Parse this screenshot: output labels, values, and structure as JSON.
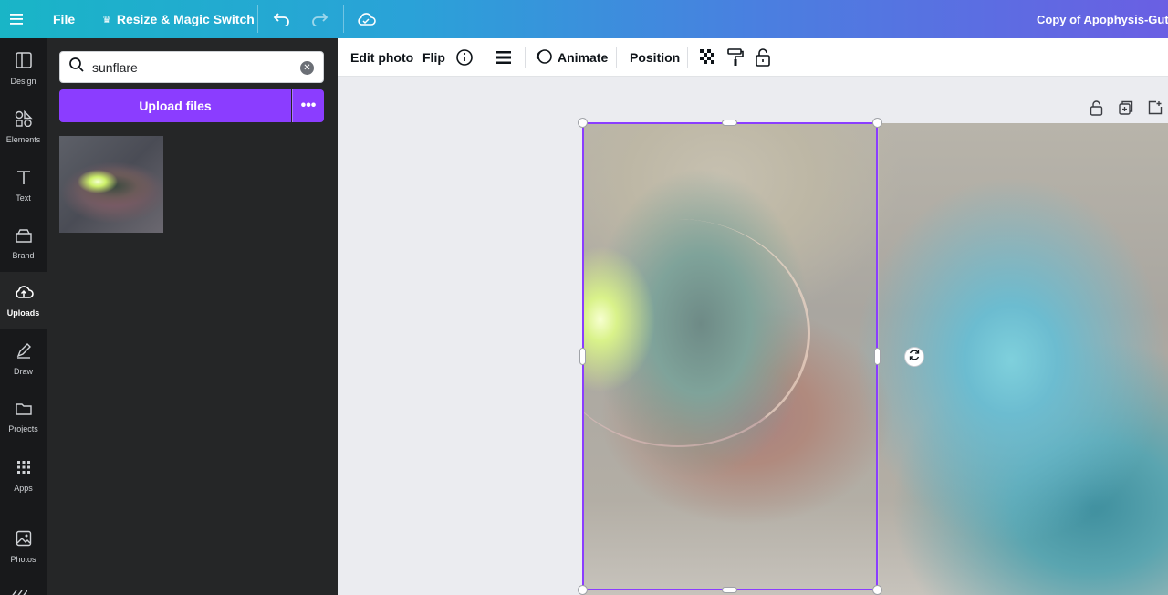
{
  "topbar": {
    "menu_icon": "hamburger-icon",
    "file_label": "File",
    "resize_label": "Resize & Magic Switch",
    "undo_icon": "undo-icon",
    "redo_icon": "redo-icon",
    "cloud_icon": "cloud-save-icon",
    "doc_title": "Copy of Apophysis-GutF"
  },
  "rail": {
    "items": [
      {
        "label": "Design",
        "icon": "layout-icon"
      },
      {
        "label": "Elements",
        "icon": "shapes-icon"
      },
      {
        "label": "Text",
        "icon": "text-icon"
      },
      {
        "label": "Brand",
        "icon": "brand-icon"
      },
      {
        "label": "Uploads",
        "icon": "cloud-upload-icon",
        "active": true
      },
      {
        "label": "Draw",
        "icon": "pen-icon"
      },
      {
        "label": "Projects",
        "icon": "folder-icon"
      },
      {
        "label": "Apps",
        "icon": "apps-grid-icon"
      },
      {
        "label": "Photos",
        "icon": "photo-icon"
      }
    ]
  },
  "panel": {
    "search_value": "sunflare",
    "upload_label": "Upload files",
    "more_label": "•••"
  },
  "context": {
    "edit_photo": "Edit photo",
    "flip": "Flip",
    "animate": "Animate",
    "position": "Position"
  },
  "colors": {
    "accent": "#8b3dff",
    "panel_bg": "#252627",
    "rail_bg": "#18191b"
  }
}
